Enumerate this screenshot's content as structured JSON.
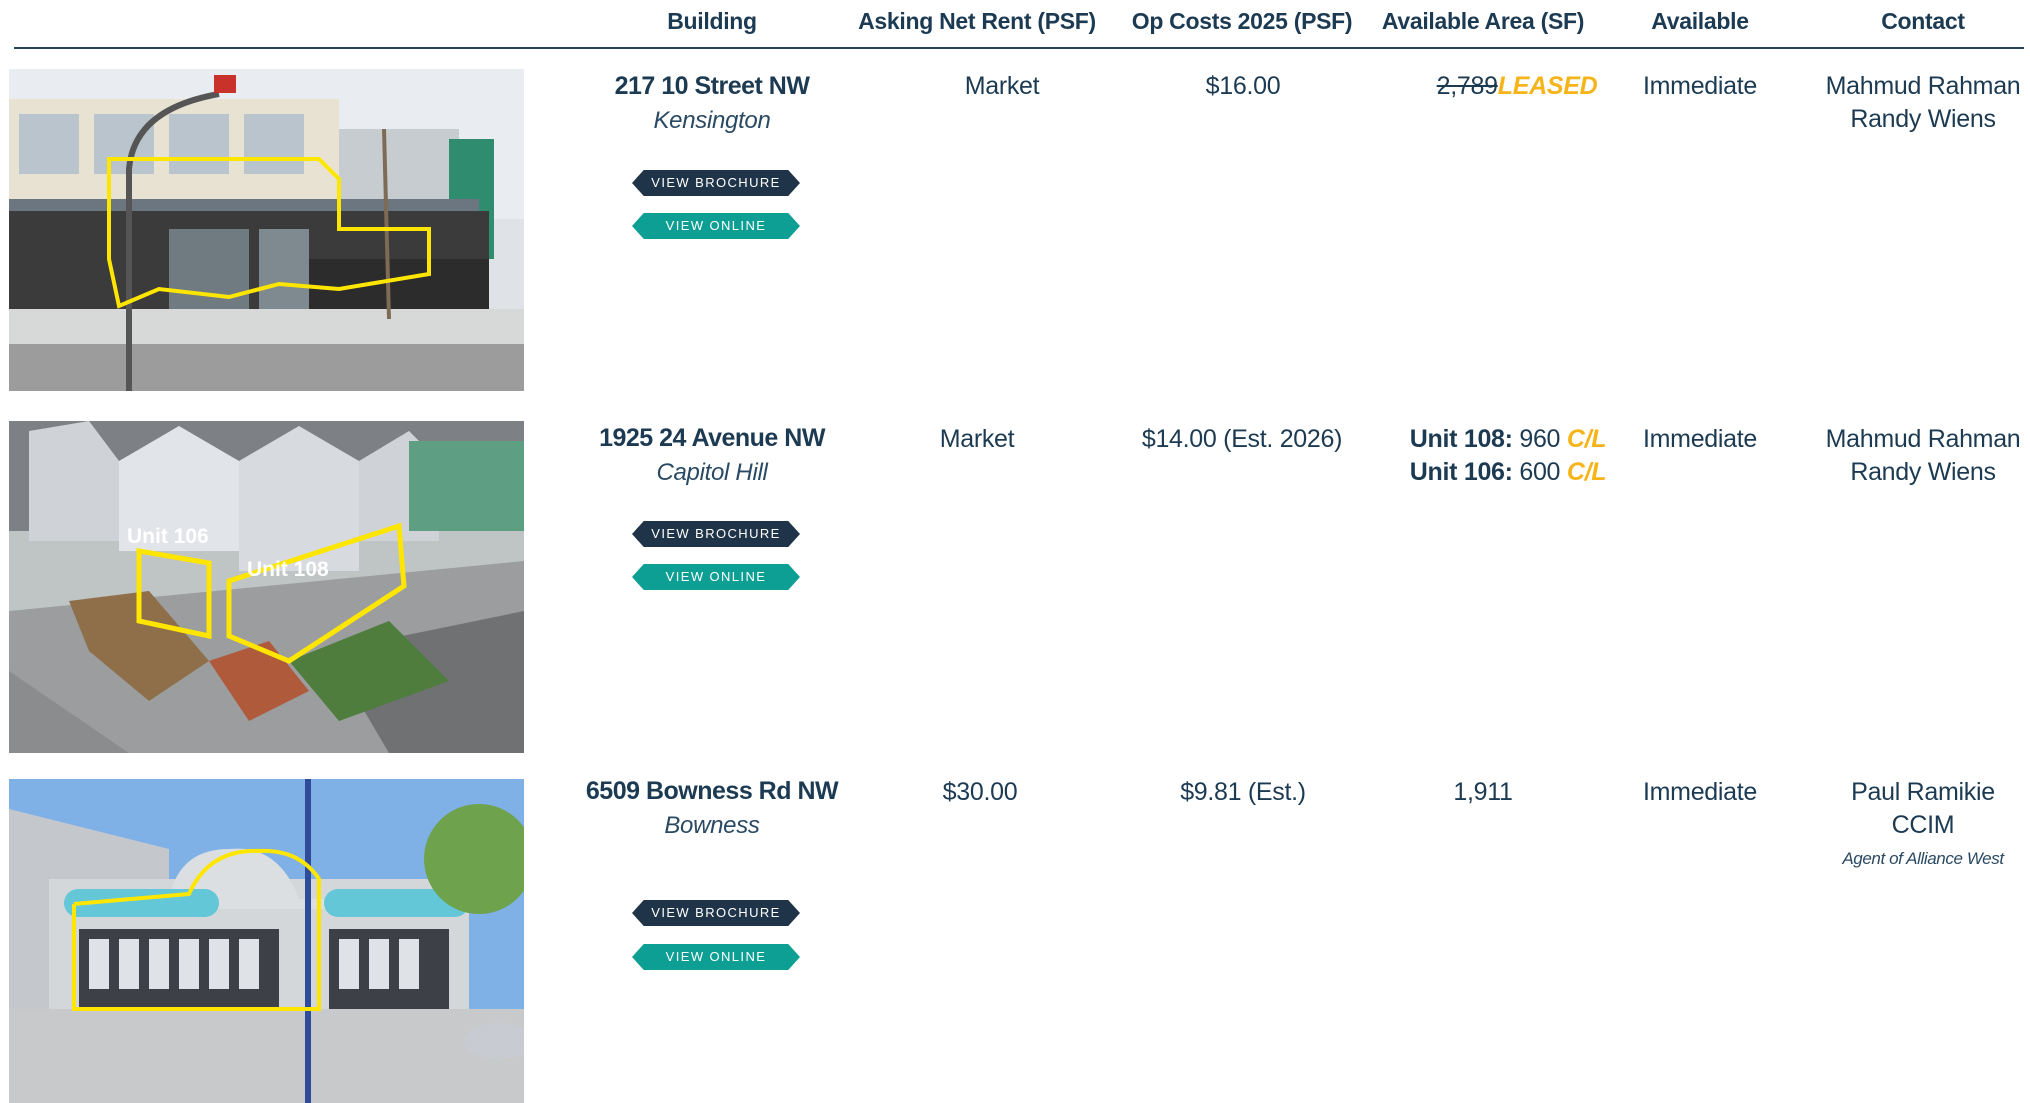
{
  "headers": {
    "building": "Building",
    "rent": "Asking Net Rent (PSF)",
    "opcosts": "Op Costs 2025 (PSF)",
    "area": "Available Area (SF)",
    "available": "Available",
    "contact": "Contact"
  },
  "buttons": {
    "brochure": "VIEW BROCHURE",
    "online": "VIEW ONLINE"
  },
  "colors": {
    "navy": "#1c3a52",
    "teal": "#0e9f94",
    "gold": "#f5b51a",
    "outline": "#ffe600"
  },
  "listings": [
    {
      "address": "217 10 Street NW",
      "neighbourhood": "Kensington",
      "rent": "Market",
      "opcosts": "$16.00",
      "area_struck": "2,789",
      "area_status": "LEASED",
      "available": "Immediate",
      "contact_1": "Mahmud Rahman",
      "contact_2": "Randy Wiens"
    },
    {
      "address": "1925 24 Avenue NW",
      "neighbourhood": "Capitol Hill",
      "rent": "Market",
      "opcosts": "$14.00 (Est. 2026)",
      "unit_a_label": "Unit 108:",
      "unit_a_value": "960",
      "unit_a_status": "C/L",
      "unit_b_label": "Unit 106:",
      "unit_b_value": "600",
      "unit_b_status": "C/L",
      "photo_tag_a": "Unit 106",
      "photo_tag_b": "Unit 108",
      "available": "Immediate",
      "contact_1": "Mahmud Rahman",
      "contact_2": "Randy Wiens"
    },
    {
      "address": "6509 Bowness Rd NW",
      "neighbourhood": "Bowness",
      "rent": "$30.00",
      "opcosts": "$9.81 (Est.)",
      "area": "1,911",
      "available": "Immediate",
      "contact_1": "Paul Ramikie",
      "contact_2": "CCIM",
      "contact_note": "Agent of Alliance West"
    }
  ]
}
